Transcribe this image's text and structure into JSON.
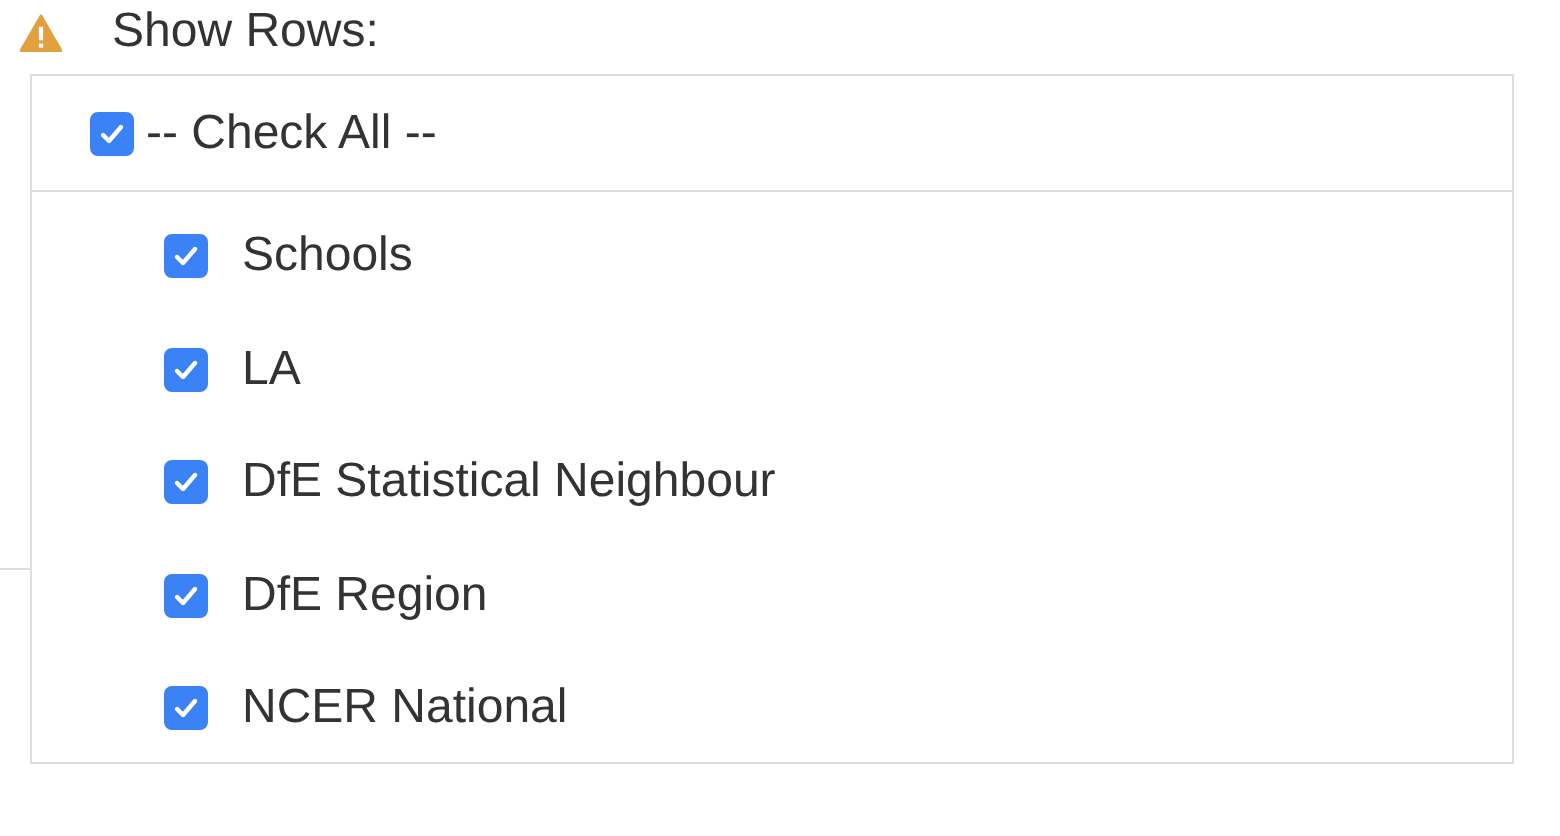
{
  "header": {
    "label": "Show Rows:"
  },
  "check_all": {
    "label": "-- Check All --",
    "checked": true
  },
  "rows": [
    {
      "label": "Schools",
      "checked": true
    },
    {
      "label": "LA",
      "checked": true
    },
    {
      "label": "DfE Statistical Neighbour",
      "checked": true
    },
    {
      "label": "DfE Region",
      "checked": true
    },
    {
      "label": "NCER National",
      "checked": true
    }
  ]
}
